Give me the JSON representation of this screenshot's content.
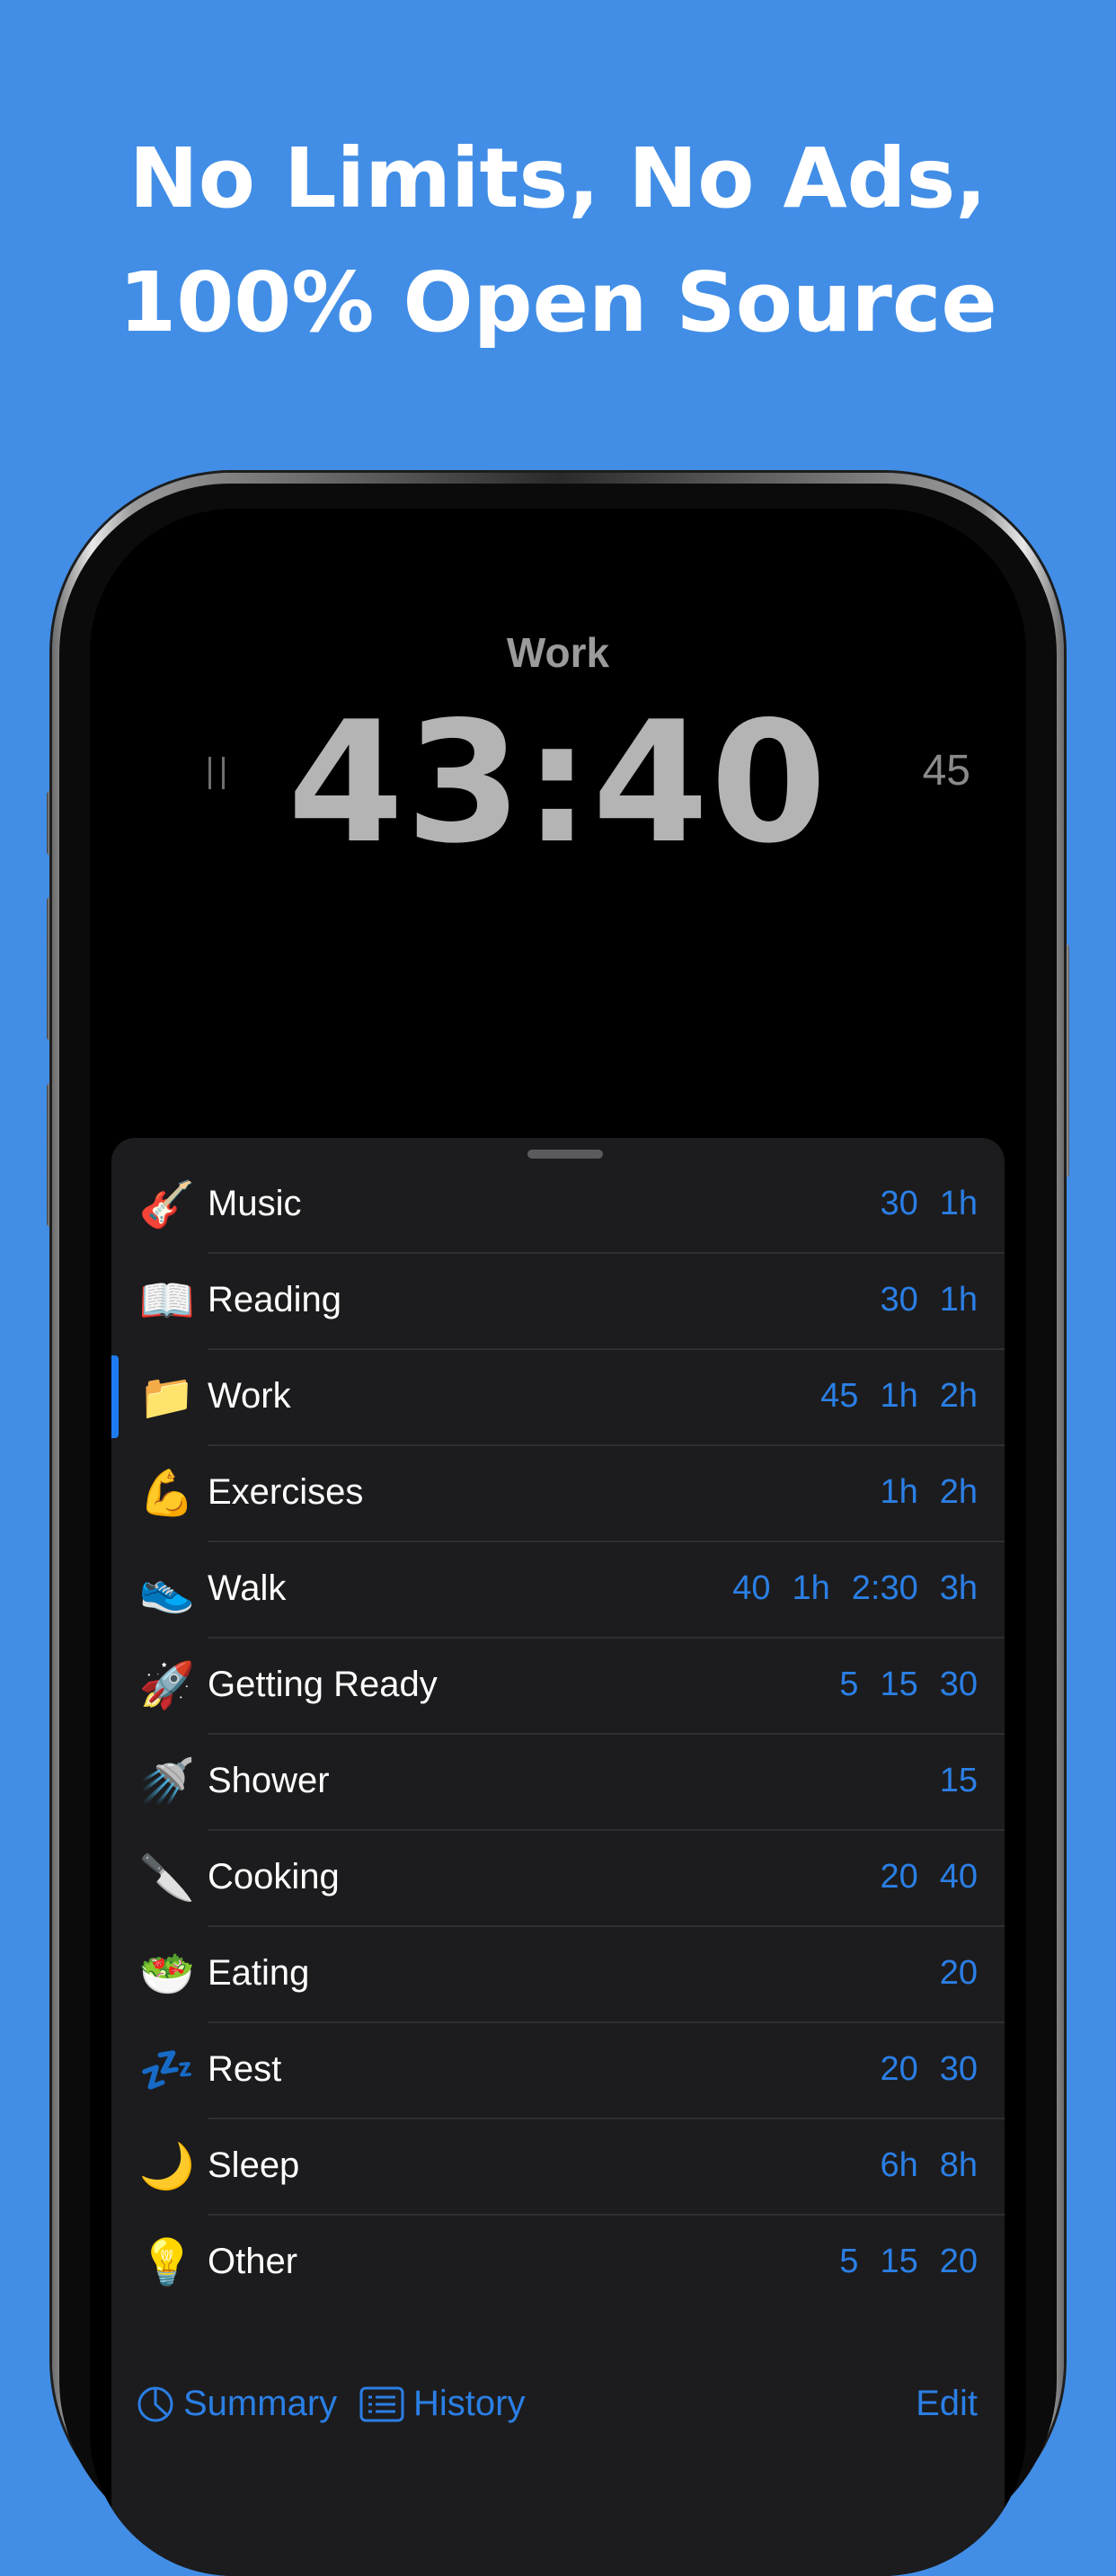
{
  "promo": {
    "line1": "No Limits, No Ads,",
    "line2": "100% Open Source"
  },
  "timer_screen": {
    "task": "Work",
    "time": "43:40",
    "preset_minutes": "45"
  },
  "tasks": [
    {
      "emoji": "🎸",
      "name": "Music",
      "presets": [
        "30",
        "1h"
      ]
    },
    {
      "emoji": "📖",
      "name": "Reading",
      "presets": [
        "30",
        "1h"
      ]
    },
    {
      "emoji": "📁",
      "name": "Work",
      "presets": [
        "45",
        "1h",
        "2h"
      ],
      "active": true
    },
    {
      "emoji": "💪",
      "name": "Exercises",
      "presets": [
        "1h",
        "2h"
      ]
    },
    {
      "emoji": "👟",
      "name": "Walk",
      "presets": [
        "40",
        "1h",
        "2:30",
        "3h"
      ]
    },
    {
      "emoji": "🚀",
      "name": "Getting Ready",
      "presets": [
        "5",
        "15",
        "30"
      ]
    },
    {
      "emoji": "🚿",
      "name": "Shower",
      "presets": [
        "15"
      ]
    },
    {
      "emoji": "🔪",
      "name": "Cooking",
      "presets": [
        "20",
        "40"
      ]
    },
    {
      "emoji": "🥗",
      "name": "Eating",
      "presets": [
        "20"
      ]
    },
    {
      "emoji": "💤",
      "name": "Rest",
      "presets": [
        "20",
        "30"
      ]
    },
    {
      "emoji": "🌙",
      "name": "Sleep",
      "presets": [
        "6h",
        "8h"
      ]
    },
    {
      "emoji": "💡",
      "name": "Other",
      "presets": [
        "5",
        "15",
        "20"
      ]
    }
  ],
  "toolbar": {
    "summary_label": "Summary",
    "history_label": "History",
    "edit_label": "Edit"
  },
  "colors": {
    "background": "#428ee6",
    "accent": "#2b7fe5",
    "sheet": "#1c1c1e"
  },
  "icons": {
    "summary": "pie-chart-icon",
    "history": "list-icon",
    "pause": "pause-icon"
  }
}
